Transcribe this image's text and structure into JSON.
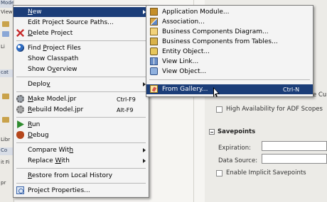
{
  "background": {
    "left_fragments": [
      "Model",
      "Views",
      "Li",
      "cat",
      "Libr",
      "Co",
      "it Fi",
      "pr"
    ],
    "high_availability_label": "High Availability for ADF Scopes",
    "clipped_checkbox_text": "e Cu",
    "savepoints_title": "Savepoints",
    "expiration_label": "Expiration:",
    "data_source_label": "Data Source:",
    "implicit_savepoints_label": "Enable Implicit Savepoints"
  },
  "context_menu": {
    "items": [
      {
        "id": "new",
        "pre": "",
        "ul": "N",
        "post": "ew",
        "submenu": true,
        "highlighted": true,
        "icon": "none"
      },
      {
        "id": "edit-sources",
        "pre": "Edit Project Source Paths...",
        "ul": "",
        "post": "",
        "icon": "none"
      },
      {
        "id": "delete",
        "pre": "",
        "ul": "D",
        "post": "elete Project",
        "icon": "delete-icon"
      },
      {
        "id": "find-files",
        "pre": "Find ",
        "ul": "P",
        "post": "roject Files",
        "icon": "binoculars-icon"
      },
      {
        "id": "show-classpath",
        "pre": "Show Classpath",
        "ul": "",
        "post": "",
        "icon": "none"
      },
      {
        "id": "show-overview",
        "pre": "Show O",
        "ul": "v",
        "post": "erview",
        "icon": "none"
      },
      {
        "id": "deploy",
        "pre": "Deplo",
        "ul": "y",
        "post": "",
        "submenu": true,
        "icon": "none"
      },
      {
        "id": "make",
        "pre": "",
        "ul": "M",
        "post": "ake Model.jpr",
        "accel": "Ctrl-F9",
        "icon": "make-gear-icon"
      },
      {
        "id": "rebuild",
        "pre": "",
        "ul": "R",
        "post": "ebuild Model.jpr",
        "accel": "Alt-F9",
        "icon": "rebuild-gear-icon"
      },
      {
        "id": "run",
        "pre": "",
        "ul": "R",
        "post": "un",
        "icon": "run-icon"
      },
      {
        "id": "debug",
        "pre": "",
        "ul": "D",
        "post": "ebug",
        "icon": "debug-icon"
      },
      {
        "id": "compare",
        "pre": "Compare Wit",
        "ul": "h",
        "post": "",
        "submenu": true,
        "icon": "none"
      },
      {
        "id": "replace",
        "pre": "Replace ",
        "ul": "W",
        "post": "ith",
        "submenu": true,
        "icon": "none"
      },
      {
        "id": "restore",
        "pre": "",
        "ul": "R",
        "post": "estore from Local History",
        "icon": "none"
      },
      {
        "id": "properties",
        "pre": "Pro",
        "ul": "j",
        "post": "ect Properties...",
        "icon": "properties-icon"
      }
    ]
  },
  "submenu": {
    "items": [
      {
        "id": "app-module",
        "label": "Application Module...",
        "icon": "application-module-icon"
      },
      {
        "id": "association",
        "label": "Association...",
        "icon": "association-icon"
      },
      {
        "id": "bc-diagram",
        "label": "Business Components Diagram...",
        "icon": "bc-diagram-icon"
      },
      {
        "id": "bc-tables",
        "label": "Business Components from Tables...",
        "icon": "bc-tables-icon"
      },
      {
        "id": "entity-object",
        "label": "Entity Object...",
        "icon": "entity-object-icon"
      },
      {
        "id": "view-link",
        "label": "View Link...",
        "icon": "view-link-icon"
      },
      {
        "id": "view-object",
        "label": "View Object...",
        "icon": "view-object-icon"
      },
      {
        "id": "from-gallery",
        "label": "From Gallery...",
        "accel": "Ctrl-N",
        "highlighted": true,
        "icon": "gallery-icon"
      }
    ]
  }
}
